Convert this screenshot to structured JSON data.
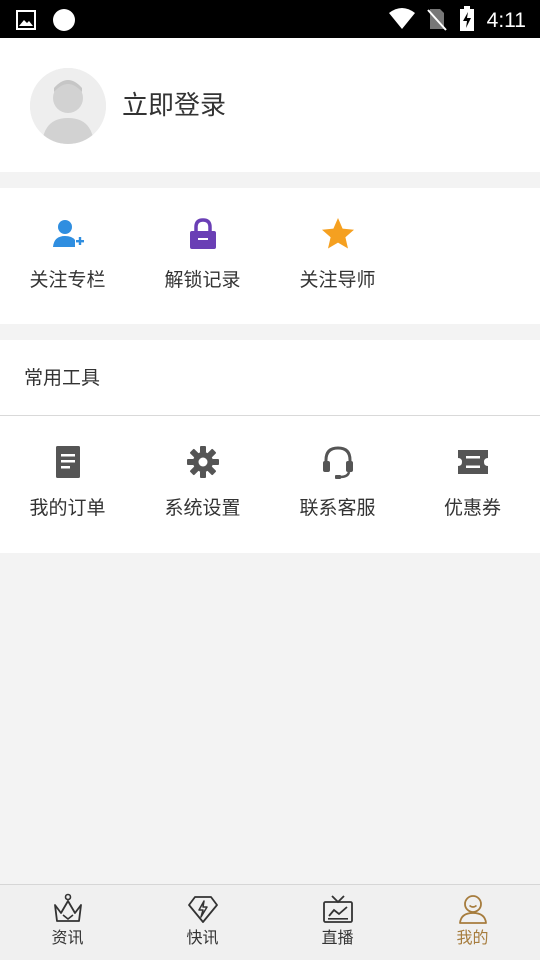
{
  "status_bar": {
    "time": "4:11",
    "icons": [
      "image-icon",
      "circle-icon",
      "wifi-icon",
      "no-sim-icon",
      "battery-charging-icon"
    ]
  },
  "profile": {
    "login_label": "立即登录",
    "avatar_icon": "default-avatar-icon"
  },
  "quick_links": [
    {
      "label": "关注专栏",
      "icon": "user-add-icon",
      "color": "#2f8ee0"
    },
    {
      "label": "解锁记录",
      "icon": "unlock-icon",
      "color": "#6a3fb5"
    },
    {
      "label": "关注导师",
      "icon": "star-icon",
      "color": "#f5a020"
    }
  ],
  "tools": {
    "title": "常用工具",
    "items": [
      {
        "label": "我的订单",
        "icon": "document-icon"
      },
      {
        "label": "系统设置",
        "icon": "gear-icon"
      },
      {
        "label": "联系客服",
        "icon": "headset-icon"
      },
      {
        "label": "优惠券",
        "icon": "ticket-icon"
      }
    ]
  },
  "bottom_nav": [
    {
      "label": "资讯",
      "icon": "crown-icon",
      "active": false
    },
    {
      "label": "快讯",
      "icon": "lightning-gem-icon",
      "active": false
    },
    {
      "label": "直播",
      "icon": "tv-icon",
      "active": false
    },
    {
      "label": "我的",
      "icon": "user-icon",
      "active": true
    }
  ],
  "colors": {
    "active_tab": "#a67c3d",
    "tool_icon": "#555555",
    "background": "#f3f3f3"
  }
}
